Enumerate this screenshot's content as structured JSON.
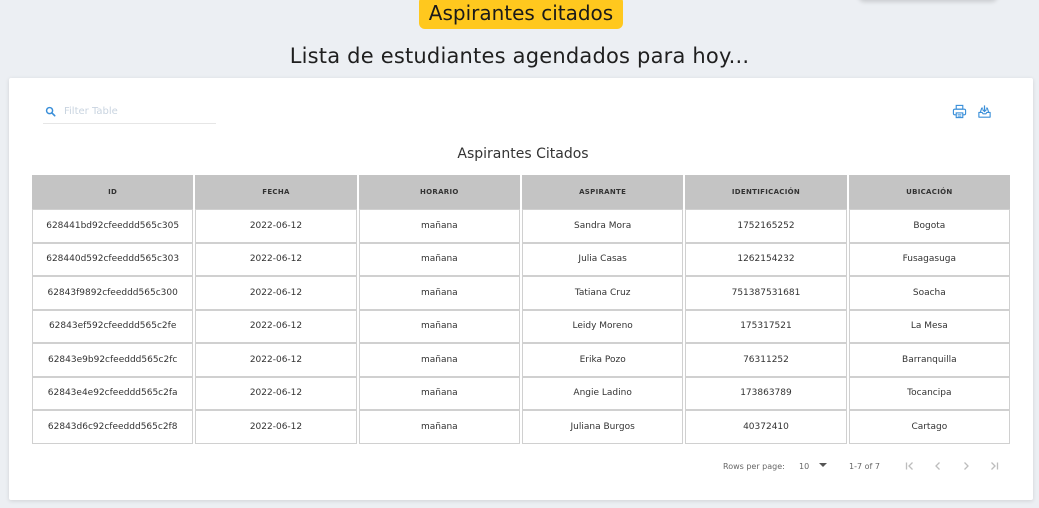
{
  "header": {
    "badge_label": "Aspirantes citados",
    "subtitle": "Lista de estudiantes agendados para hoy..."
  },
  "toolbar": {
    "search_placeholder": "Filter Table",
    "print_icon": "printer-icon",
    "download_icon": "download-icon"
  },
  "table": {
    "title": "Aspirantes Citados",
    "columns": [
      "ID",
      "FECHA",
      "HORARIO",
      "ASPIRANTE",
      "IDENTIFICACIÓN",
      "UBICACIÓN"
    ],
    "rows": [
      [
        "628441bd92cfeeddd565c305",
        "2022-06-12",
        "mañana",
        "Sandra Mora",
        "1752165252",
        "Bogota"
      ],
      [
        "628440d592cfeeddd565c303",
        "2022-06-12",
        "mañana",
        "Julia Casas",
        "1262154232",
        "Fusagasuga"
      ],
      [
        "62843f9892cfeeddd565c300",
        "2022-06-12",
        "mañana",
        "Tatiana Cruz",
        "751387531681",
        "Soacha"
      ],
      [
        "62843ef592cfeeddd565c2fe",
        "2022-06-12",
        "mañana",
        "Leidy Moreno",
        "175317521",
        "La Mesa"
      ],
      [
        "62843e9b92cfeeddd565c2fc",
        "2022-06-12",
        "mañana",
        "Erika Pozo",
        "76311252",
        "Barranquilla"
      ],
      [
        "62843e4e92cfeeddd565c2fa",
        "2022-06-12",
        "mañana",
        "Angie Ladino",
        "173863789",
        "Tocancipa"
      ],
      [
        "62843d6c92cfeeddd565c2f8",
        "2022-06-12",
        "mañana",
        "Juliana Burgos",
        "40372410",
        "Cartago"
      ]
    ]
  },
  "pagination": {
    "rows_per_page_label": "Rows per page:",
    "rows_per_page_value": "10",
    "range": "1-7 of 7"
  },
  "colors": {
    "badge": "#ffc81e",
    "icon_blue": "#3a8fd9",
    "header_gray": "#c4c4c4"
  }
}
